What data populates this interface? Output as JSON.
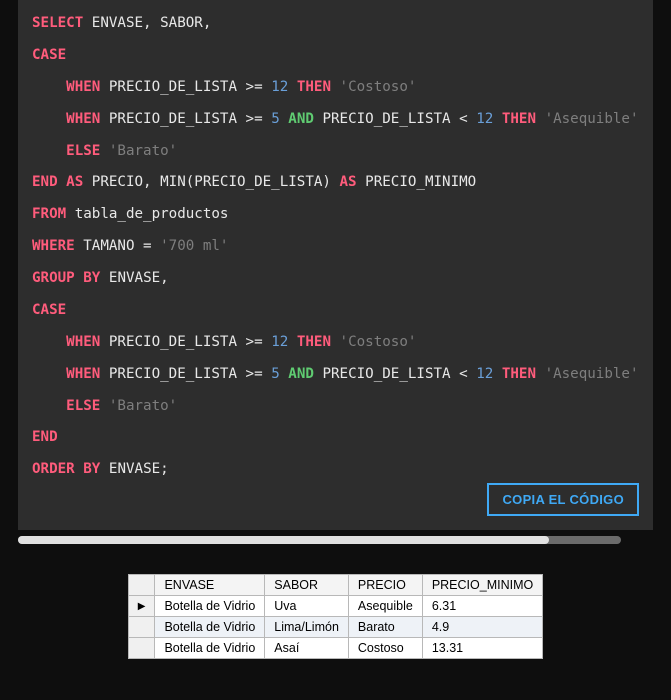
{
  "copy_button_label": "COPIA EL CÓDIGO",
  "code": {
    "l1_select": "SELECT",
    "l1_rest": " ENVASE, SABOR,",
    "l2_case": "CASE",
    "l3_when": "    WHEN",
    "l3_mid": " PRECIO_DE_LISTA >= ",
    "l3_num": "12",
    "l3_then": " THEN ",
    "l3_str": "'Costoso'",
    "l4_when": "    WHEN",
    "l4_mid1": " PRECIO_DE_LISTA >= ",
    "l4_num1": "5",
    "l4_sp1": " ",
    "l4_and": "AND",
    "l4_mid2": " PRECIO_DE_LISTA < ",
    "l4_num2": "12",
    "l4_sp2": " ",
    "l4_then": "THEN",
    "l4_sp3": " ",
    "l4_str": "'Asequible'",
    "l5_else": "    ELSE",
    "l5_sp": " ",
    "l5_str": "'Barato'",
    "l6_end": "END",
    "l6_sp1": " ",
    "l6_as1": "AS",
    "l6_mid": " PRECIO, MIN(PRECIO_DE_LISTA) ",
    "l6_as2": "AS",
    "l6_rest": " PRECIO_MINIMO",
    "l7_from": "FROM",
    "l7_rest": " tabla_de_productos",
    "l8_where": "WHERE",
    "l8_mid": " TAMANO = ",
    "l8_str": "'700 ml'",
    "l9_group": "GROUP",
    "l9_sp": " ",
    "l9_by": "BY",
    "l9_rest": " ENVASE,",
    "l10_case": "CASE",
    "l11_when": "    WHEN",
    "l11_mid": " PRECIO_DE_LISTA >= ",
    "l11_num": "12",
    "l11_then": " THEN ",
    "l11_str": "'Costoso'",
    "l12_when": "    WHEN",
    "l12_mid1": " PRECIO_DE_LISTA >= ",
    "l12_num1": "5",
    "l12_sp1": " ",
    "l12_and": "AND",
    "l12_mid2": " PRECIO_DE_LISTA < ",
    "l12_num2": "12",
    "l12_sp2": " ",
    "l12_then": "THEN",
    "l12_sp3": " ",
    "l12_str": "'Asequible'",
    "l13_else": "    ELSE",
    "l13_sp": " ",
    "l13_str": "'Barato'",
    "l14_end": "END",
    "l15_order": "ORDER",
    "l15_sp": " ",
    "l15_by": "BY",
    "l15_rest": " ENVASE;"
  },
  "result": {
    "row_marker": "▶",
    "headers": {
      "c1": "ENVASE",
      "c2": "SABOR",
      "c3": "PRECIO",
      "c4": "PRECIO_MINIMO"
    },
    "rows": [
      {
        "c1": "Botella de Vidrio",
        "c2": "Uva",
        "c3": "Asequible",
        "c4": "6.31"
      },
      {
        "c1": "Botella de Vidrio",
        "c2": "Lima/Limón",
        "c3": "Barato",
        "c4": "4.9"
      },
      {
        "c1": "Botella de Vidrio",
        "c2": "Asaí",
        "c3": "Costoso",
        "c4": "13.31"
      }
    ]
  }
}
